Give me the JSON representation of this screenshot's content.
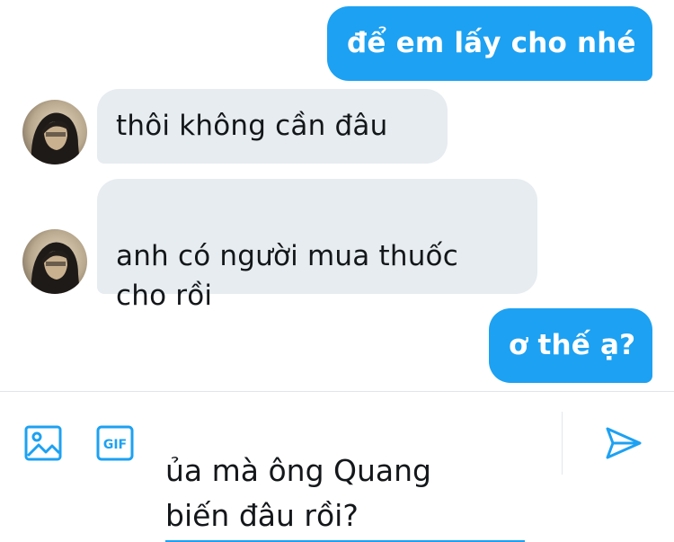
{
  "messages": [
    {
      "direction": "outgoing",
      "text": "để em lấy cho nhé"
    },
    {
      "direction": "incoming",
      "text": "thôi không cần đâu"
    },
    {
      "direction": "incoming",
      "text": "anh có người mua thuốc\ncho rồi"
    },
    {
      "direction": "outgoing",
      "text": "ơ thế ạ?"
    }
  ],
  "composer": {
    "input_value": "ủa mà ông Quang\nbiến đâu rồi?",
    "gif_label": "GIF",
    "image_icon": "image-icon",
    "gif_icon": "gif-icon",
    "send_icon": "send-icon"
  },
  "colors": {
    "outgoing_bubble": "#1da1f2",
    "incoming_bubble": "#e6ecf0",
    "accent": "#1da1f2"
  }
}
